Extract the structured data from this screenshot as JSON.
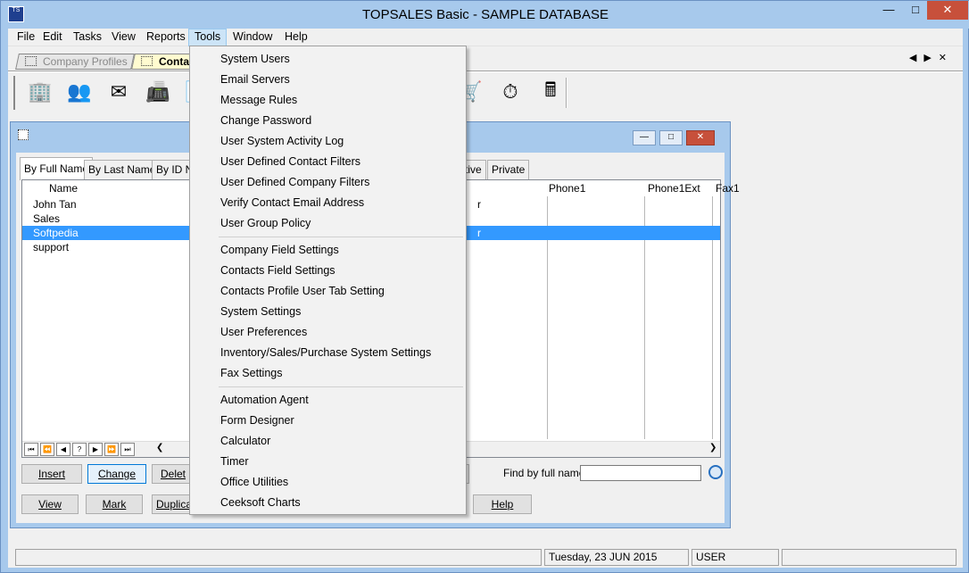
{
  "window": {
    "title": "TOPSALES Basic - SAMPLE DATABASE",
    "icon_text": "TS"
  },
  "menubar": [
    "File",
    "Edit",
    "Tasks",
    "View",
    "Reports",
    "Tools",
    "Window",
    "Help"
  ],
  "profile_tabs": {
    "company": "Company Profiles",
    "contacts": "Contac"
  },
  "toolbar_icons": [
    "company-icon",
    "contacts-icon",
    "letter-icon",
    "fax-icon",
    "document-icon",
    "sales-icon",
    "stopwatch-icon",
    "calculator-icon"
  ],
  "child_tabs": [
    "By Full Name",
    "By Last Name",
    "By ID N",
    "ctive",
    "Private"
  ],
  "grid": {
    "columns": [
      "Name",
      "Phone1",
      "Phone1Ext",
      "Fax1"
    ],
    "rows": [
      "John Tan",
      "Sales",
      "Softpedia",
      "support"
    ],
    "row_fragments": [
      "r",
      "r"
    ],
    "selected_row": 2
  },
  "buttons": {
    "insert": "Insert",
    "change": "Change",
    "delete": "Delet",
    "view": "View",
    "mark": "Mark",
    "duplicate": "Duplica",
    "help": "Help"
  },
  "find": {
    "label": "Find by full name:",
    "value": ""
  },
  "status": {
    "date": "Tuesday, 23 JUN 2015",
    "user": "USER"
  },
  "tools_menu": {
    "group1": [
      "System Users",
      "Email Servers",
      "Message Rules",
      "Change Password",
      "User System Activity Log",
      "User Defined Contact Filters",
      "User Defined Company Filters",
      "Verify Contact Email Address",
      "User Group Policy"
    ],
    "group2": [
      "Company Field Settings",
      "Contacts Field Settings",
      "Contacts Profile User Tab Setting",
      "System Settings",
      "User Preferences",
      "Inventory/Sales/Purchase System Settings",
      "Fax Settings"
    ],
    "group3": [
      "Automation Agent",
      "Form Designer",
      "Calculator",
      "Timer",
      "Office Utilities",
      "Ceeksoft Charts"
    ]
  }
}
